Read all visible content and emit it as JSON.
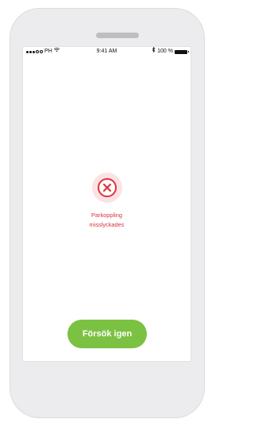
{
  "status_bar": {
    "carrier": "PH",
    "time": "9:41 AM",
    "battery": "100 %"
  },
  "error": {
    "line1": "Parkoppling",
    "line2": "misslyckades",
    "icon": "close-icon",
    "color": "#d9343b"
  },
  "actions": {
    "retry_label": "Försök igen",
    "accent": "#7bc142"
  }
}
